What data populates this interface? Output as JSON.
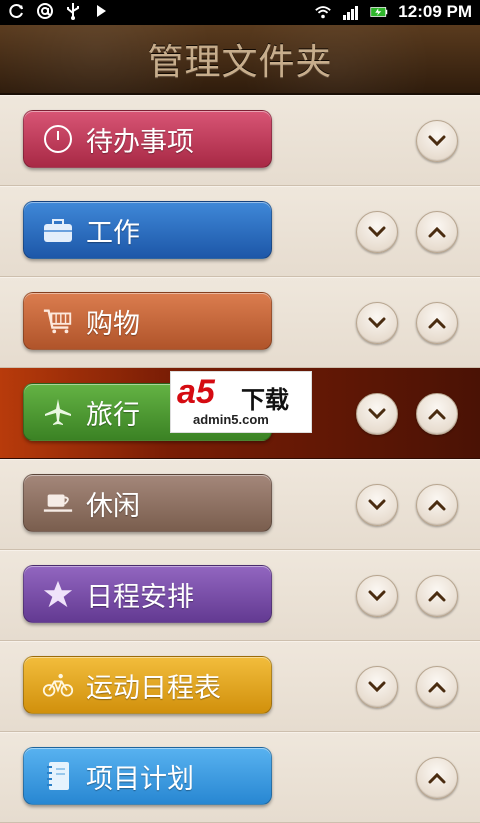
{
  "status_bar": {
    "left_icons": [
      "sync-icon",
      "at-icon",
      "usb-icon",
      "play-icon"
    ],
    "right_icons": [
      "wifi-icon",
      "signal-icon",
      "battery-charging-icon"
    ],
    "time": "12:09 PM"
  },
  "title": "管理文件夹",
  "colors": {
    "title_bar": "#3f2914",
    "highlight_row": "#8a2508",
    "todo": "#c43c5a",
    "work": "#2b6fc3",
    "shopping": "#c8683b",
    "travel": "#4e9a33",
    "leisure": "#8e6e5a",
    "schedule": "#7a4ea8",
    "exercise": "#e3a61c",
    "project": "#3c9ee4"
  },
  "folders": [
    {
      "label": "待办事项",
      "icon": "clock-icon",
      "color": "#c43c5a",
      "down": true,
      "up": false
    },
    {
      "label": "工作",
      "icon": "briefcase-icon",
      "color": "#2b6fc3",
      "down": true,
      "up": true
    },
    {
      "label": "购物",
      "icon": "cart-icon",
      "color": "#c8683b",
      "down": true,
      "up": true
    },
    {
      "label": "旅行",
      "icon": "airplane-icon",
      "color": "#4e9a33",
      "down": true,
      "up": true
    },
    {
      "label": "休闲",
      "icon": "coffee-icon",
      "color": "#8e6e5a",
      "down": true,
      "up": true
    },
    {
      "label": "日程安排",
      "icon": "star-icon",
      "color": "#7a4ea8",
      "down": true,
      "up": true
    },
    {
      "label": "运动日程表",
      "icon": "bicycle-icon",
      "color": "#e3a61c",
      "down": true,
      "up": true
    },
    {
      "label": "项目计划",
      "icon": "notebook-icon",
      "color": "#3c9ee4",
      "down": false,
      "up": true
    }
  ],
  "watermark": {
    "logo": "a5",
    "text": "下载",
    "url": "admin5.com"
  }
}
